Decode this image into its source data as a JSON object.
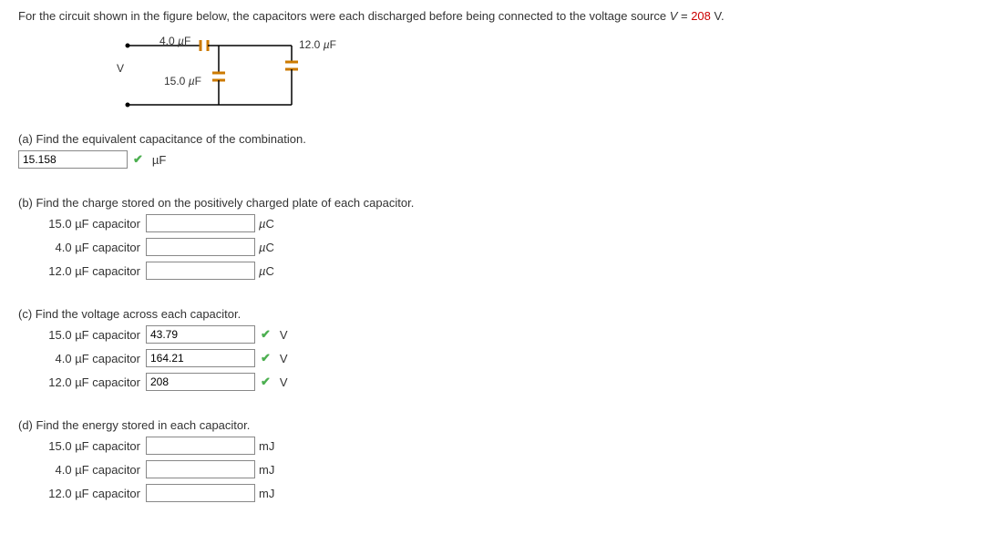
{
  "problem": {
    "text_before": "For the circuit shown in the figure below, the capacitors were each discharged before being connected to the voltage source ",
    "var": "V",
    "equals": " = ",
    "value": "208",
    "text_after": " V."
  },
  "circuit": {
    "v_label": "V",
    "c1": "4.0 µF",
    "c2": "12.0 µF",
    "c3": "15.0 µF"
  },
  "part_a": {
    "prompt": "(a) Find the equivalent capacitance of the combination.",
    "value": "15.158",
    "unit": "µF"
  },
  "part_b": {
    "prompt": "(b) Find the charge stored on the positively charged plate of each capacitor.",
    "rows": [
      {
        "label": "15.0 µF capacitor",
        "value": "",
        "unit": "µC"
      },
      {
        "label": "4.0 µF capacitor",
        "value": "",
        "unit": "µC"
      },
      {
        "label": "12.0 µF capacitor",
        "value": "",
        "unit": "µC"
      }
    ]
  },
  "part_c": {
    "prompt": "(c) Find the voltage across each capacitor.",
    "rows": [
      {
        "label": "15.0 µF capacitor",
        "value": "43.79",
        "unit": "V"
      },
      {
        "label": "4.0 µF capacitor",
        "value": "164.21",
        "unit": "V"
      },
      {
        "label": "12.0 µF capacitor",
        "value": "208",
        "unit": "V"
      }
    ]
  },
  "part_d": {
    "prompt": "(d) Find the energy stored in each capacitor.",
    "rows": [
      {
        "label": "15.0 µF capacitor",
        "value": "",
        "unit": "mJ"
      },
      {
        "label": "4.0 µF capacitor",
        "value": "",
        "unit": "mJ"
      },
      {
        "label": "12.0 µF capacitor",
        "value": "",
        "unit": "mJ"
      }
    ]
  }
}
